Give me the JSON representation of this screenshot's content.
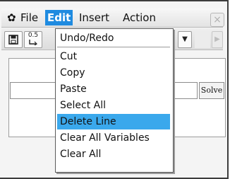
{
  "menubar": {
    "gear_icon": "gear-icon",
    "items": [
      "File",
      "Edit",
      "Insert",
      "Action"
    ],
    "close_symbol": "×"
  },
  "toolbar": {
    "save_icon": "floppy-disk-icon",
    "frac_label": "0.5",
    "dropdown_arrow": "▼",
    "play_symbol": "▶"
  },
  "main": {
    "solve_label": "Solve",
    "input_value": ""
  },
  "edit_menu": {
    "items": [
      "Undo/Redo",
      "Cut",
      "Copy",
      "Paste",
      "Select All",
      "Delete Line",
      "Clear All Variables",
      "Clear All"
    ],
    "selected": "Delete Line",
    "highlight_color": "#3aa8ec"
  },
  "colors": {
    "active_menu_bg": "#1f8be0",
    "screen_bg": "#f4f4f4"
  }
}
